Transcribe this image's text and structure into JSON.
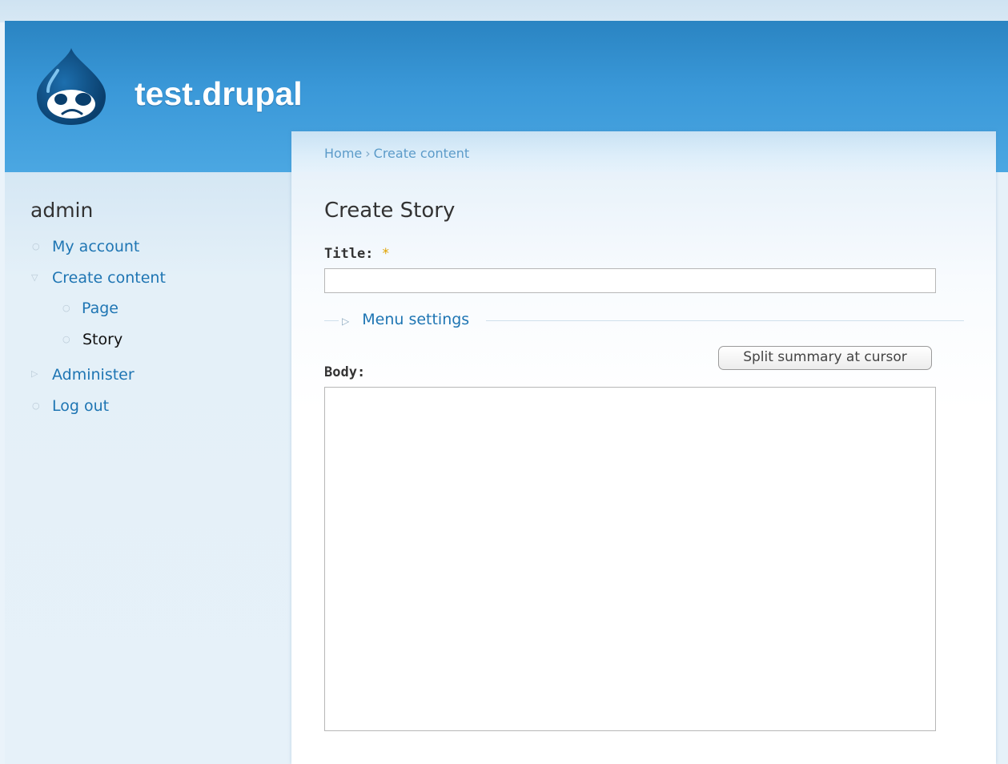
{
  "site": {
    "name": "test.drupal",
    "logo_icon": "drupal-drop-icon",
    "brand_color": "#2a84c2"
  },
  "breadcrumb": {
    "home": "Home",
    "separator": "›",
    "current": "Create content"
  },
  "sidebar": {
    "heading": "admin",
    "items": [
      {
        "label": "My account",
        "icon": "circle-bullet-icon"
      },
      {
        "label": "Create content",
        "icon": "triangle-down-icon"
      },
      {
        "label": "Page",
        "icon": "circle-bullet-icon"
      },
      {
        "label": "Story",
        "icon": "circle-bullet-icon"
      },
      {
        "label": "Administer",
        "icon": "triangle-right-icon"
      },
      {
        "label": "Log out",
        "icon": "circle-bullet-icon"
      }
    ]
  },
  "form": {
    "page_title": "Create Story",
    "title_label": "Title:",
    "required_marker": "*",
    "title_value": "",
    "menu_settings_label": "Menu settings",
    "split_button_label": "Split summary at cursor",
    "body_label": "Body:",
    "body_value": ""
  }
}
